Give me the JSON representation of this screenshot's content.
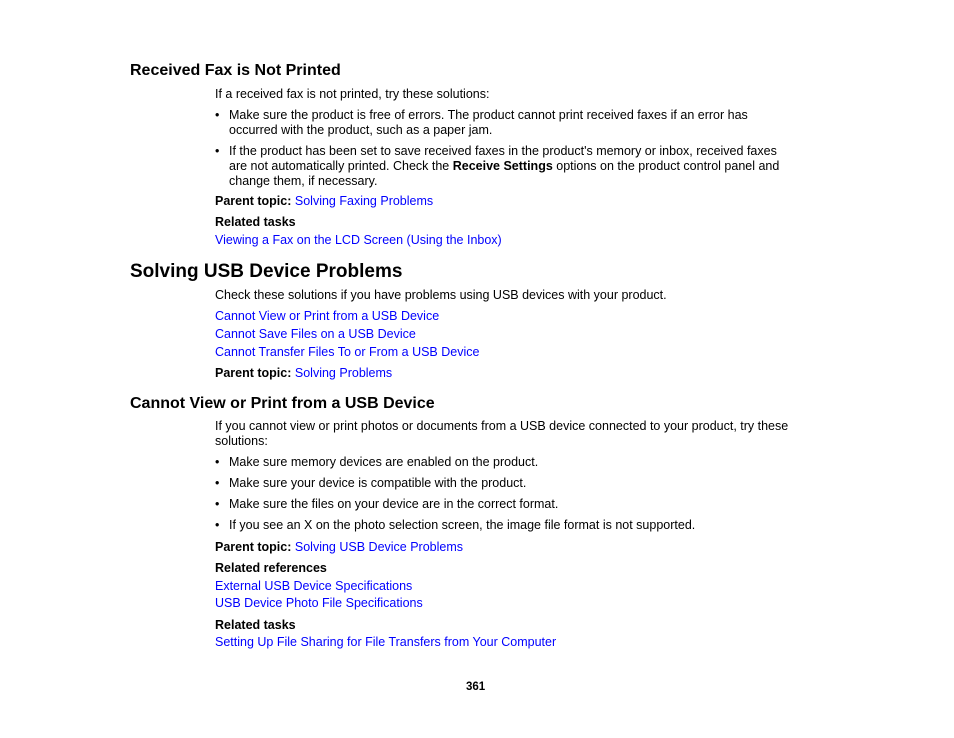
{
  "sections": {
    "fax": {
      "title": "Received Fax is Not Printed",
      "intro": "If a received fax is not printed, try these solutions:",
      "bullet1_line1": "Make sure the product is free of errors. The product cannot print received faxes if an error has",
      "bullet1_line2": "occurred with the product, such as a paper jam.",
      "bullet2_line1": "If the product has been set to save received faxes in the product's memory or inbox, received faxes",
      "bullet2_line2_pre": "are not automatically printed. Check the ",
      "bullet2_line2_bold": "Receive Settings",
      "bullet2_line2_post": " options on the product control panel and",
      "bullet2_line3": "change them, if necessary.",
      "parent_label": "Parent topic:",
      "parent_link": "Solving Faxing Problems",
      "related_tasks_label": "Related tasks",
      "related_tasks": [
        "Viewing a Fax on the LCD Screen (Using the Inbox)"
      ]
    },
    "usb": {
      "title": "Solving USB Device Problems",
      "intro": "Check these solutions if you have problems using USB devices with your product.",
      "links": [
        "Cannot View or Print from a USB Device",
        "Cannot Save Files on a USB Device",
        "Cannot Transfer Files To or From a USB Device"
      ],
      "parent_label": "Parent topic:",
      "parent_link": "Solving Problems"
    },
    "view": {
      "title": "Cannot View or Print from a USB Device",
      "intro_line1": "If you cannot view or print photos or documents from a USB device connected to your product, try these",
      "intro_line2": "solutions:",
      "bullets": [
        "Make sure memory devices are enabled on the product.",
        "Make sure your device is compatible with the product.",
        "Make sure the files on your device are in the correct format.",
        "If you see an X on the photo selection screen, the image file format is not supported."
      ],
      "parent_label": "Parent topic:",
      "parent_link": "Solving USB Device Problems",
      "related_refs_label": "Related references",
      "related_refs": [
        "External USB Device Specifications",
        "USB Device Photo File Specifications"
      ],
      "related_tasks_label": "Related tasks",
      "related_tasks": [
        "Setting Up File Sharing for File Transfers from Your Computer"
      ]
    }
  },
  "bullet_char": "•",
  "page_number": "361"
}
